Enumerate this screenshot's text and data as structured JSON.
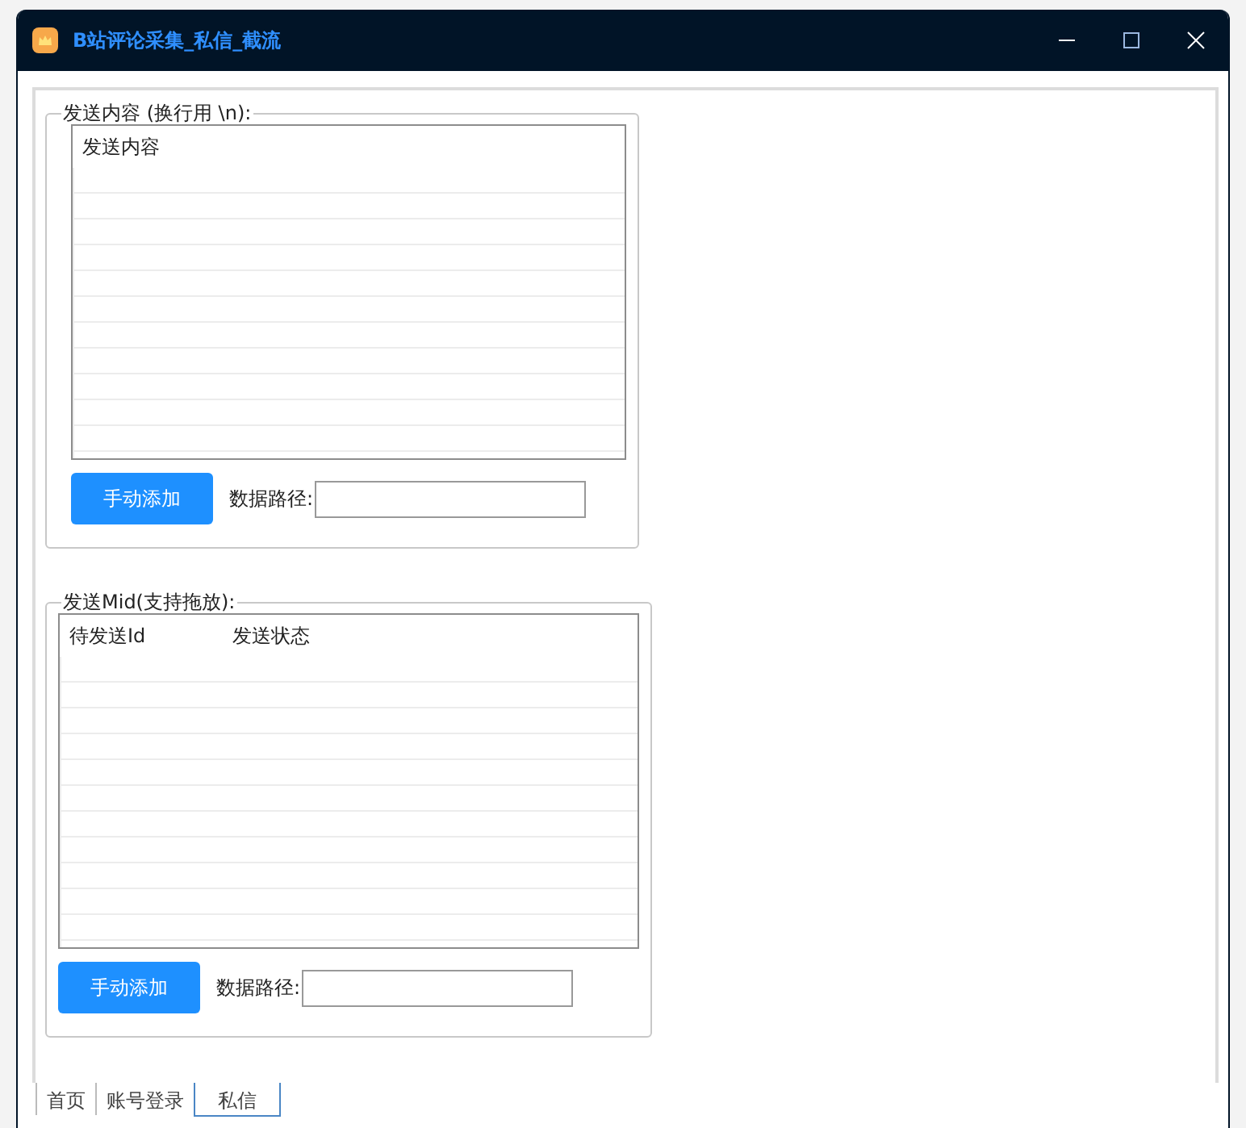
{
  "window": {
    "title": "B站评论采集_私信_截流"
  },
  "content_group": {
    "legend": "发送内容 (换行用 \\n):",
    "list": {
      "columns": [
        "发送内容"
      ]
    },
    "add_button": "手动添加",
    "path_label": "数据路径:"
  },
  "mid_group": {
    "legend": "发送Mid(支持拖放):",
    "list": {
      "columns": [
        "待发送Id",
        "发送状态"
      ]
    },
    "add_button": "手动添加",
    "path_label": "数据路径:"
  },
  "tabs": [
    {
      "label": "首页",
      "selected": false
    },
    {
      "label": "账号登录",
      "selected": false
    },
    {
      "label": "私信",
      "selected": true
    }
  ]
}
